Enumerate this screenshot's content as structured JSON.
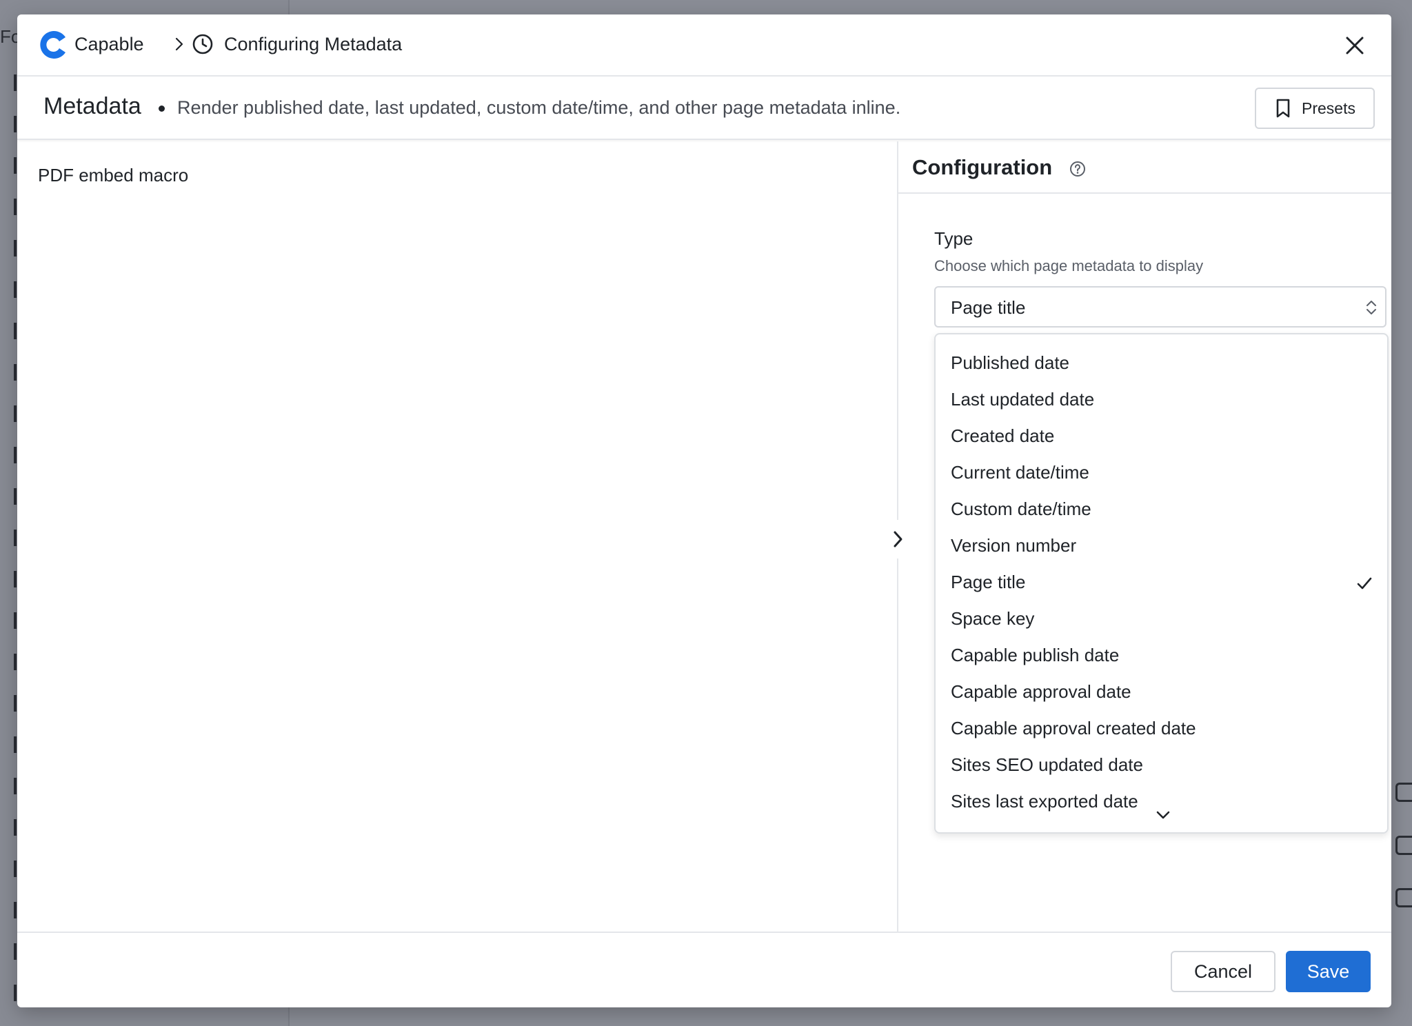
{
  "background": {
    "partial_text": "Fo"
  },
  "topbar": {
    "app_name": "Capable",
    "breadcrumb_title": "Configuring Metadata"
  },
  "macro": {
    "name": "Metadata",
    "description": "Render published date, last updated, custom date/time, and other page metadata inline.",
    "presets_label": "Presets"
  },
  "preview": {
    "text": "PDF embed macro"
  },
  "config": {
    "title": "Configuration",
    "type_field": {
      "label": "Type",
      "help": "Choose which page metadata to display",
      "selected": "Page title",
      "options": [
        {
          "label": "Published date"
        },
        {
          "label": "Last updated date"
        },
        {
          "label": "Created date"
        },
        {
          "label": "Current date/time"
        },
        {
          "label": "Custom date/time"
        },
        {
          "label": "Version number"
        },
        {
          "label": "Page title",
          "selected": true
        },
        {
          "label": "Space key"
        },
        {
          "label": "Capable publish date"
        },
        {
          "label": "Capable approval date"
        },
        {
          "label": "Capable approval created date"
        },
        {
          "label": "Sites SEO updated date"
        },
        {
          "label": "Sites last exported date"
        }
      ]
    }
  },
  "footer": {
    "cancel_label": "Cancel",
    "save_label": "Save"
  },
  "colors": {
    "accent": "#1f6ed4",
    "logo": "#1a73e8"
  }
}
